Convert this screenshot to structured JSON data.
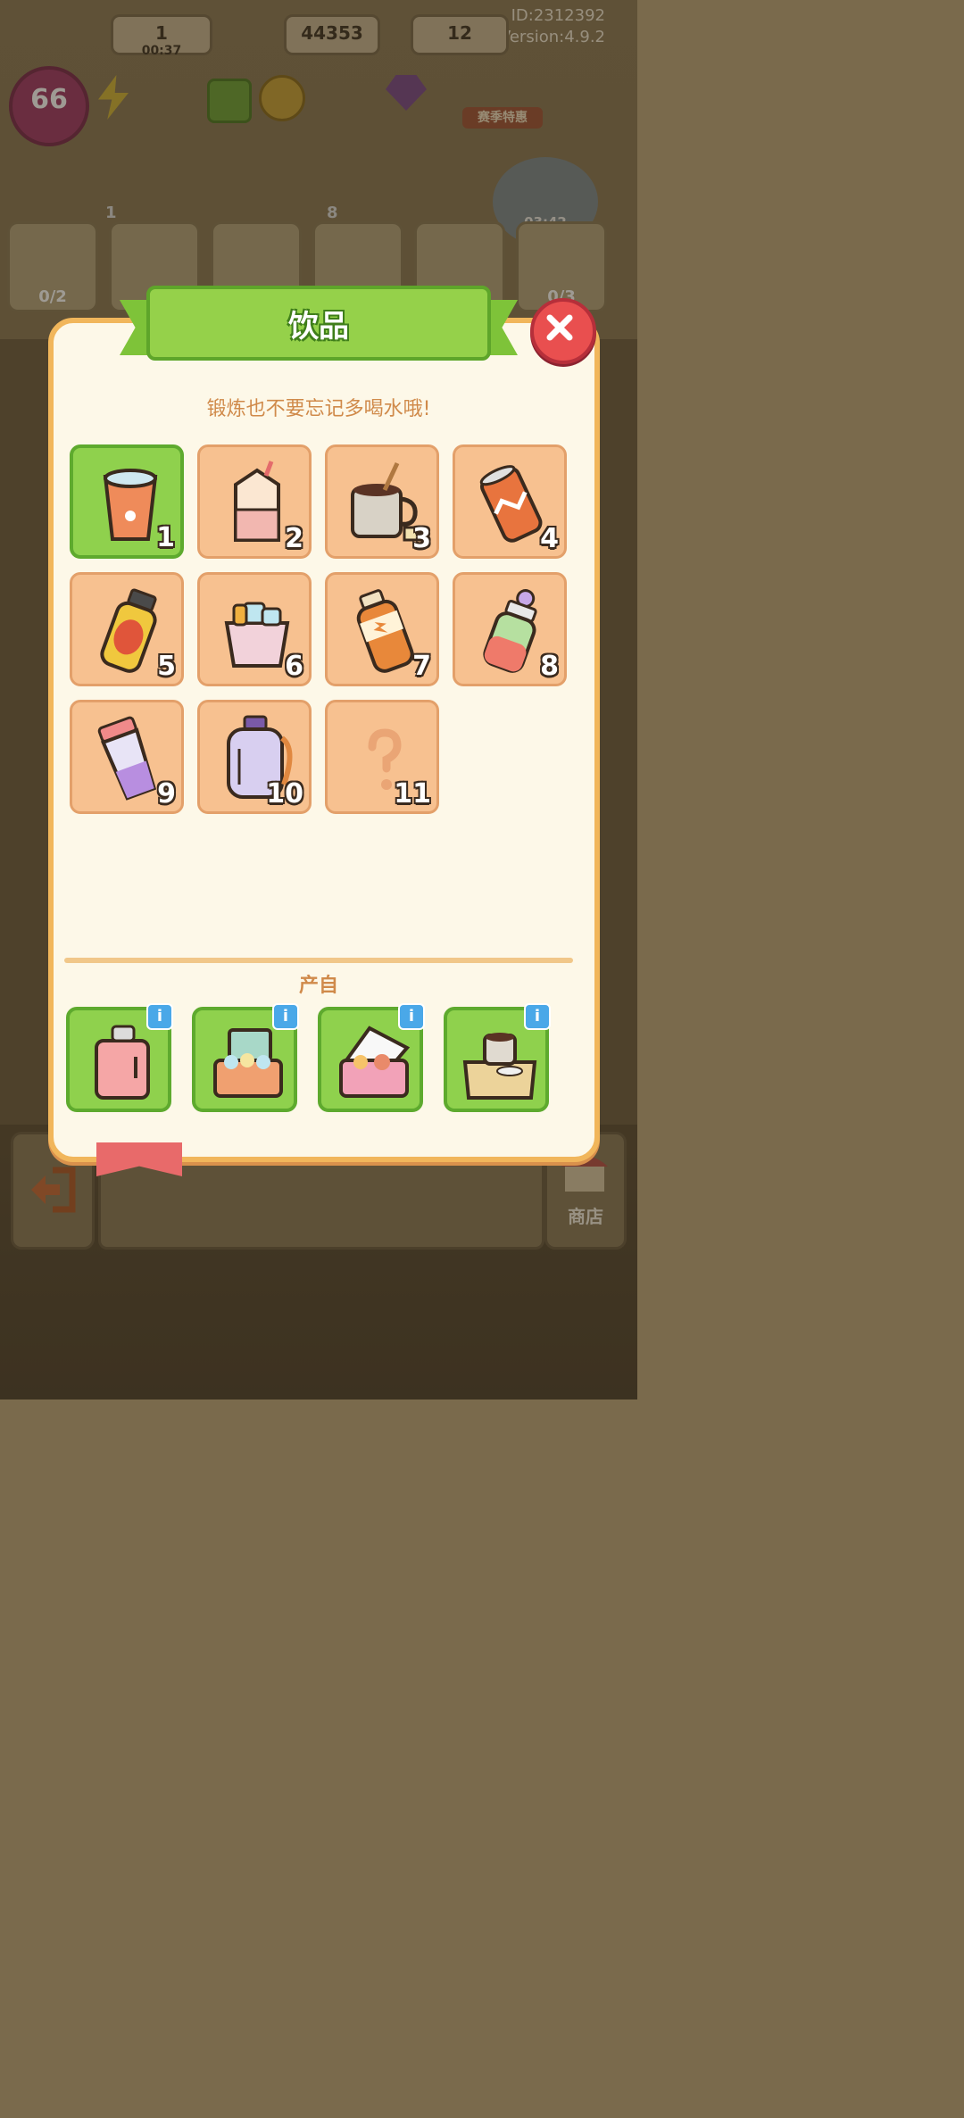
{
  "header": {
    "id_text": "ID:2312392",
    "version_text": "Version:4.9.2",
    "level": "66",
    "energy": "1",
    "energy_timer": "00:37",
    "coins": "44353",
    "gems": "12",
    "promo_label": "赛季特惠",
    "event_timer": "03:42"
  },
  "background_shelf": [
    {
      "count": "0/2"
    },
    {
      "count": "0/3"
    }
  ],
  "background_stars": [
    "1",
    "8"
  ],
  "bottom_bar": {
    "shop_label": "商店"
  },
  "dialog": {
    "title": "饮品",
    "subtitle": "锻炼也不要忘记多喝水哦!",
    "items": [
      {
        "number": "1",
        "icon": "water-cup-icon",
        "unlocked": true,
        "selected": true
      },
      {
        "number": "2",
        "icon": "milk-carton-icon",
        "unlocked": true,
        "selected": false
      },
      {
        "number": "3",
        "icon": "coffee-mug-icon",
        "unlocked": true,
        "selected": false
      },
      {
        "number": "4",
        "icon": "soda-can-icon",
        "unlocked": true,
        "selected": false
      },
      {
        "number": "5",
        "icon": "juice-bottle-icon",
        "unlocked": true,
        "selected": false
      },
      {
        "number": "6",
        "icon": "ice-bucket-icon",
        "unlocked": true,
        "selected": false
      },
      {
        "number": "7",
        "icon": "energy-drink-icon",
        "unlocked": true,
        "selected": false
      },
      {
        "number": "8",
        "icon": "sports-bottle-icon",
        "unlocked": true,
        "selected": false
      },
      {
        "number": "9",
        "icon": "shaker-bottle-icon",
        "unlocked": true,
        "selected": false
      },
      {
        "number": "10",
        "icon": "water-jug-icon",
        "unlocked": true,
        "selected": false
      },
      {
        "number": "11",
        "icon": "question-mark-icon",
        "unlocked": false,
        "selected": false
      }
    ],
    "source_label": "产自",
    "sources": [
      {
        "icon": "mini-fridge-icon",
        "info": "i"
      },
      {
        "icon": "cooler-box-icon",
        "info": "i"
      },
      {
        "icon": "pink-cooler-icon",
        "info": "i"
      },
      {
        "icon": "coffee-box-icon",
        "info": "i"
      }
    ],
    "colors": {
      "accent_green": "#95d14a",
      "slot_peach": "#f7c190",
      "close_red": "#e94f4f",
      "text_brown": "#d08a4a"
    }
  }
}
